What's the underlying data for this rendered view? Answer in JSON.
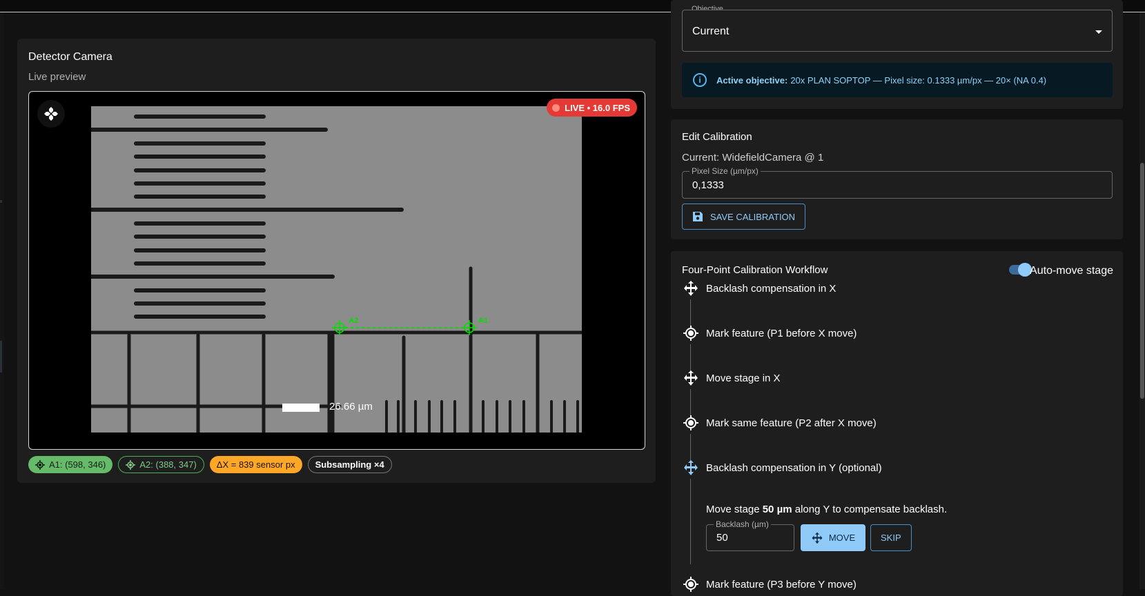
{
  "camera": {
    "title": "Detector Camera",
    "subtitle": "Live preview",
    "live_badge": "LIVE • 16.0 FPS",
    "scale_label": "26.66 µm",
    "marker_a1": "A1",
    "marker_a2": "A2",
    "chips": {
      "a1": "A1: (598, 346)",
      "a2": "A2: (388, 347)",
      "dx": "ΔX = 839 sensor px",
      "subsampling": "Subsampling ×4"
    }
  },
  "objective": {
    "legend": "Objective",
    "value": "Current",
    "info_bold": "Active objective:",
    "info_text": "20x PLAN SOPTOP — Pixel size: 0.1333 µm/px — 20× (NA 0.4)"
  },
  "edit_calibration": {
    "title": "Edit Calibration",
    "current": "Current: WidefieldCamera @ 1",
    "pixel_size_label": "Pixel Size (µm/px)",
    "pixel_size_value": "0,1333",
    "save_label": "SAVE CALIBRATION"
  },
  "workflow": {
    "title": "Four-Point Calibration Workflow",
    "auto_move_label": "Auto-move stage",
    "auto_move_on": true,
    "steps": [
      {
        "label": "Backlash compensation in X",
        "icon": "move-icon"
      },
      {
        "label": "Mark feature (P1 before X move)",
        "icon": "crosshair-icon"
      },
      {
        "label": "Move stage in X",
        "icon": "move-icon"
      },
      {
        "label": "Mark same feature (P2 after X move)",
        "icon": "crosshair-icon"
      },
      {
        "label": "Backlash compensation in Y (optional)",
        "icon": "move-icon",
        "active": true
      },
      {
        "label": "Mark feature (P3 before Y move)",
        "icon": "crosshair-icon"
      }
    ],
    "active_step": {
      "text_prefix": "Move stage ",
      "text_bold": "50 µm",
      "text_suffix": " along Y to compensate backlash.",
      "backlash_label": "Backlash (µm)",
      "backlash_value": "50",
      "move_label": "MOVE",
      "skip_label": "SKIP"
    }
  },
  "colors": {
    "accent": "#90caf9",
    "live": "#e53935",
    "marker": "#00ff00",
    "chip_a1": "#66bb6a",
    "chip_dx": "#ffa726"
  }
}
